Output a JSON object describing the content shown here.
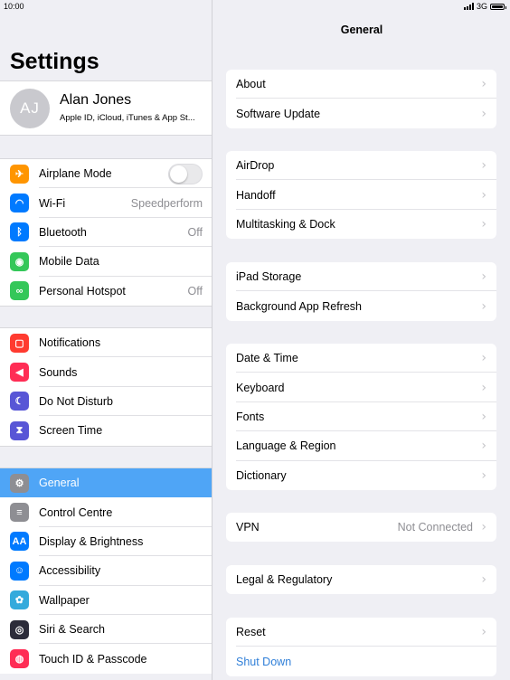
{
  "status": {
    "time": "10:00",
    "network": "3G"
  },
  "sidebar": {
    "title": "Settings",
    "profile": {
      "initials": "AJ",
      "name": "Alan Jones",
      "subtitle": "Apple ID, iCloud, iTunes & App St..."
    },
    "group1": [
      {
        "label": "Airplane Mode",
        "icon": "airplane-icon",
        "color": "#ff9500",
        "toggle": false
      },
      {
        "label": "Wi-Fi",
        "icon": "wifi-icon",
        "color": "#007aff",
        "value": "Speedperform"
      },
      {
        "label": "Bluetooth",
        "icon": "bluetooth-icon",
        "color": "#007aff",
        "value": "Off"
      },
      {
        "label": "Mobile Data",
        "icon": "antenna-icon",
        "color": "#34c759"
      },
      {
        "label": "Personal Hotspot",
        "icon": "hotspot-icon",
        "color": "#34c759",
        "value": "Off"
      }
    ],
    "group2": [
      {
        "label": "Notifications",
        "icon": "notifications-icon",
        "color": "#ff3b30"
      },
      {
        "label": "Sounds",
        "icon": "speaker-icon",
        "color": "#ff2d55"
      },
      {
        "label": "Do Not Disturb",
        "icon": "moon-icon",
        "color": "#5856d6"
      },
      {
        "label": "Screen Time",
        "icon": "hourglass-icon",
        "color": "#5856d6"
      }
    ],
    "group3": [
      {
        "label": "General",
        "icon": "gear-icon",
        "color": "#8e8e93",
        "selected": true
      },
      {
        "label": "Control Centre",
        "icon": "switches-icon",
        "color": "#8e8e93"
      },
      {
        "label": "Display & Brightness",
        "icon": "text-size-icon",
        "color": "#007aff"
      },
      {
        "label": "Accessibility",
        "icon": "accessibility-icon",
        "color": "#007aff"
      },
      {
        "label": "Wallpaper",
        "icon": "flower-icon",
        "color": "#34aadc"
      },
      {
        "label": "Siri & Search",
        "icon": "siri-icon",
        "color": "#2c2c3a"
      },
      {
        "label": "Touch ID & Passcode",
        "icon": "fingerprint-icon",
        "color": "#ff2d55"
      }
    ]
  },
  "detail": {
    "title": "General",
    "groups": [
      [
        {
          "label": "About"
        },
        {
          "label": "Software Update"
        }
      ],
      [
        {
          "label": "AirDrop"
        },
        {
          "label": "Handoff"
        },
        {
          "label": "Multitasking & Dock"
        }
      ],
      [
        {
          "label": "iPad Storage"
        },
        {
          "label": "Background App Refresh"
        }
      ],
      [
        {
          "label": "Date & Time"
        },
        {
          "label": "Keyboard"
        },
        {
          "label": "Fonts"
        },
        {
          "label": "Language & Region"
        },
        {
          "label": "Dictionary"
        }
      ],
      [
        {
          "label": "VPN",
          "value": "Not Connected"
        }
      ],
      [
        {
          "label": "Legal & Regulatory"
        }
      ],
      [
        {
          "label": "Reset"
        },
        {
          "label": "Shut Down",
          "link": true
        }
      ]
    ]
  }
}
